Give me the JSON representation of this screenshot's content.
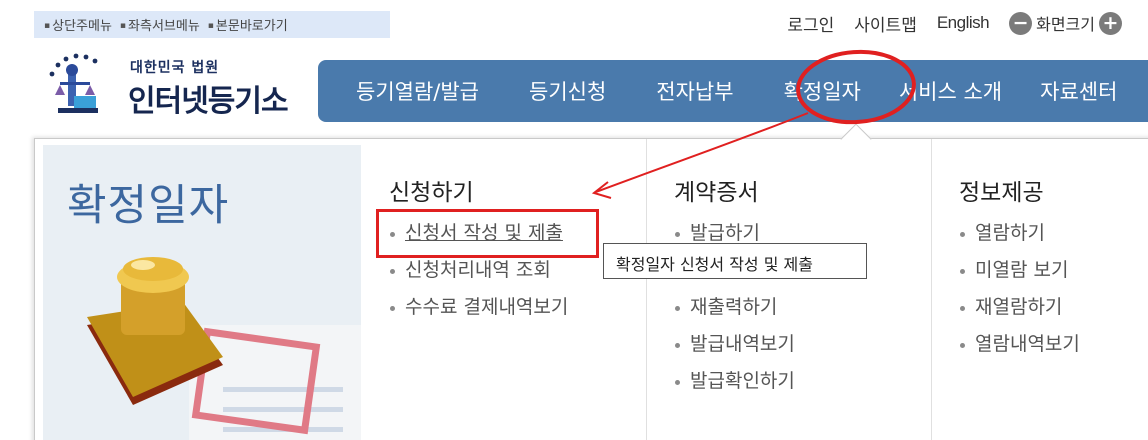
{
  "skip_links": [
    "상단주메뉴",
    "좌측서브메뉴",
    "본문바로가기"
  ],
  "utility": {
    "login": "로그인",
    "sitemap": "사이트맵",
    "english": "English",
    "zoom_out": "−",
    "zoom_label": "화면크기",
    "zoom_in": "+"
  },
  "logo": {
    "small_text": "대한민국 법원",
    "big_text": "인터넷등기소",
    "icon": "court-emblem-icon"
  },
  "nav": {
    "items": [
      "등기열람/발급",
      "등기신청",
      "전자납부",
      "확정일자",
      "서비스 소개",
      "자료센터"
    ],
    "active": "확정일자",
    "background": "#4a7aac"
  },
  "panel": {
    "title": "확정일자",
    "columns": [
      {
        "heading": "신청하기",
        "items": [
          "신청서 작성 및 제출",
          "신청처리내역 조회",
          "수수료 결제내역보기"
        ]
      },
      {
        "heading": "계약증서",
        "items": [
          "발급하기",
          "재출력하기",
          "발급내역보기",
          "발급확인하기"
        ]
      },
      {
        "heading": "정보제공",
        "items": [
          "열람하기",
          "미열람 보기",
          "재열람하기",
          "열람내역보기"
        ]
      }
    ],
    "tooltip": "확정일자 신청서 작성 및 제출"
  },
  "annotation_color": "#e02020"
}
